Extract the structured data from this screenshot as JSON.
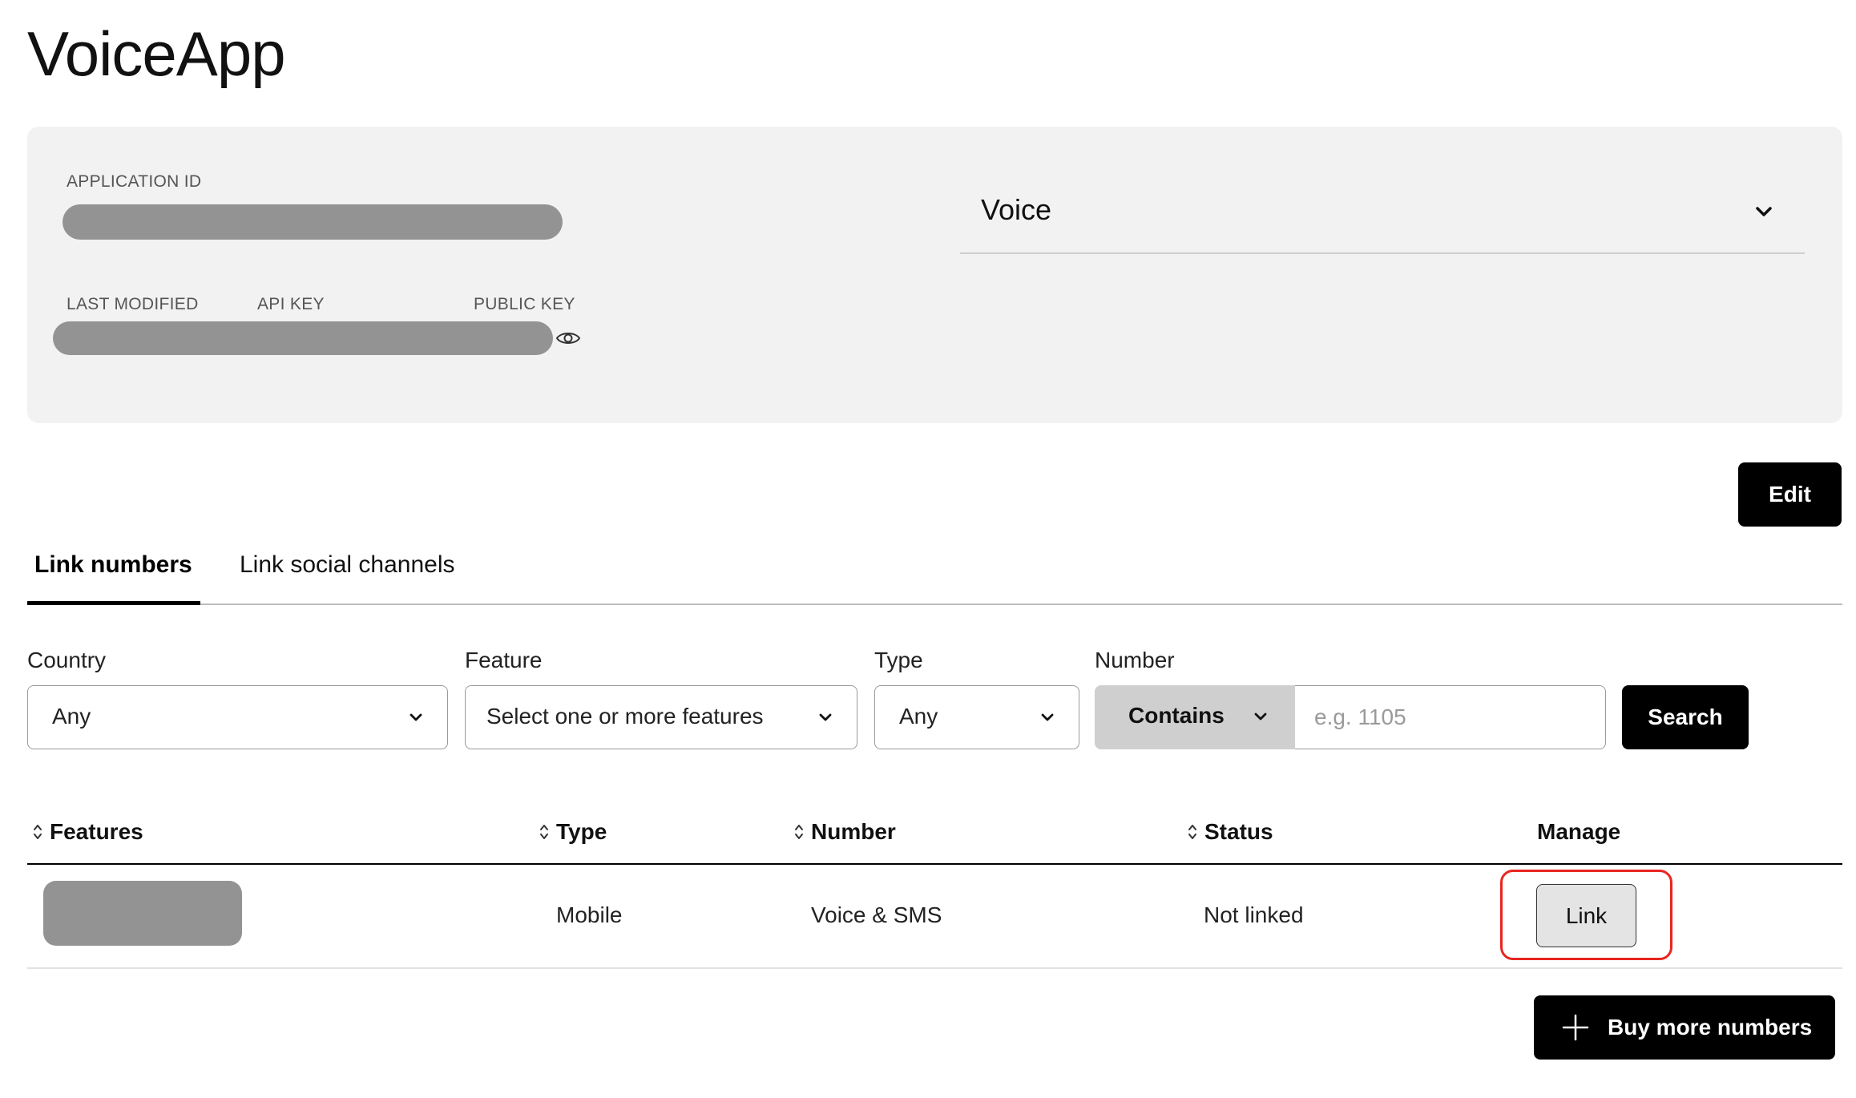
{
  "app": {
    "title": "VoiceApp"
  },
  "details": {
    "application_id_label": "APPLICATION ID",
    "last_modified_label": "LAST MODIFIED",
    "api_key_label": "API KEY",
    "public_key_label": "PUBLIC KEY",
    "capability_selected": "Voice"
  },
  "actions": {
    "edit_label": "Edit"
  },
  "tabs": [
    {
      "label": "Link numbers",
      "active": true
    },
    {
      "label": "Link social channels",
      "active": false
    }
  ],
  "filters": {
    "country": {
      "label": "Country",
      "value": "Any"
    },
    "feature": {
      "label": "Feature",
      "value": "Select one or more features"
    },
    "type": {
      "label": "Type",
      "value": "Any"
    },
    "number": {
      "label": "Number",
      "match_mode": "Contains",
      "placeholder": "e.g. 1105",
      "value": ""
    },
    "search_label": "Search"
  },
  "table": {
    "columns": [
      "Features",
      "Type",
      "Number",
      "Status",
      "Manage"
    ],
    "rows": [
      {
        "type": "Mobile",
        "number": "Voice & SMS",
        "status": "Not linked",
        "action": "Link"
      }
    ]
  },
  "buy_more_label": "Buy more numbers",
  "colors": {
    "primary": "#000000",
    "highlight": "#e8261f",
    "card_bg": "#f2f2f2",
    "redacted": "#939393"
  }
}
